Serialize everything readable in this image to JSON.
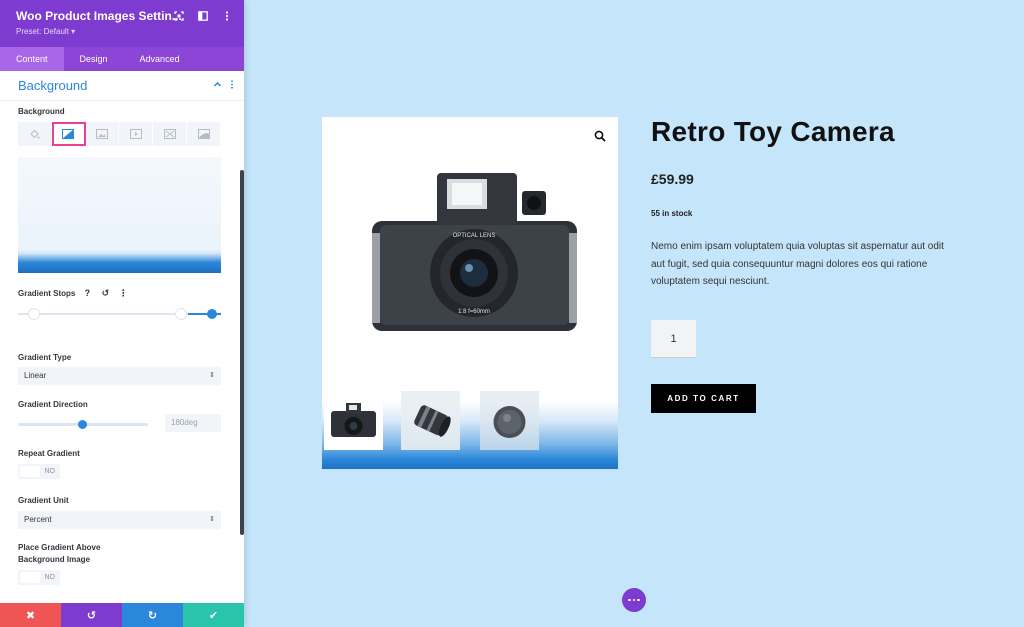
{
  "panel": {
    "title": "Woo Product Images Settin...",
    "preset": "Preset: Default ▾",
    "tabs": [
      {
        "label": "Content"
      },
      {
        "label": "Design"
      },
      {
        "label": "Advanced"
      }
    ],
    "section_title": "Background",
    "fields": {
      "background_label": "Background",
      "gradient_stops_label": "Gradient Stops",
      "gradient_type_label": "Gradient Type",
      "gradient_type_value": "Linear",
      "gradient_direction_label": "Gradient Direction",
      "gradient_direction_value": "180deg",
      "repeat_gradient_label": "Repeat Gradient",
      "repeat_gradient_value": "NO",
      "gradient_unit_label": "Gradient Unit",
      "gradient_unit_value": "Percent",
      "place_above_label_line1": "Place Gradient Above",
      "place_above_label_line2": "Background Image",
      "place_above_value": "NO"
    },
    "action_buttons": {
      "close": "✖",
      "undo": "↺",
      "redo": "↻",
      "save": "✔"
    }
  },
  "product": {
    "title": "Retro Toy Camera",
    "price": "£59.99",
    "stock": "55 in stock",
    "description": "Nemo enim ipsam voluptatem quia voluptas sit aspernatur aut odit aut fugit, sed quia consequuntur magni dolores eos qui ratione voluptatem sequi nesciunt.",
    "quantity": "1",
    "add_to_cart": "ADD TO CART"
  },
  "colors": {
    "panel_header": "#7d3bcf",
    "accent_blue": "#2b87da",
    "highlight_pink": "#ec3f9c",
    "page_bg": "#c5e5fb",
    "close_btn": "#ef5555",
    "undo_btn": "#7d3bcf",
    "redo_btn": "#2b87da",
    "save_btn": "#29c4a9"
  }
}
